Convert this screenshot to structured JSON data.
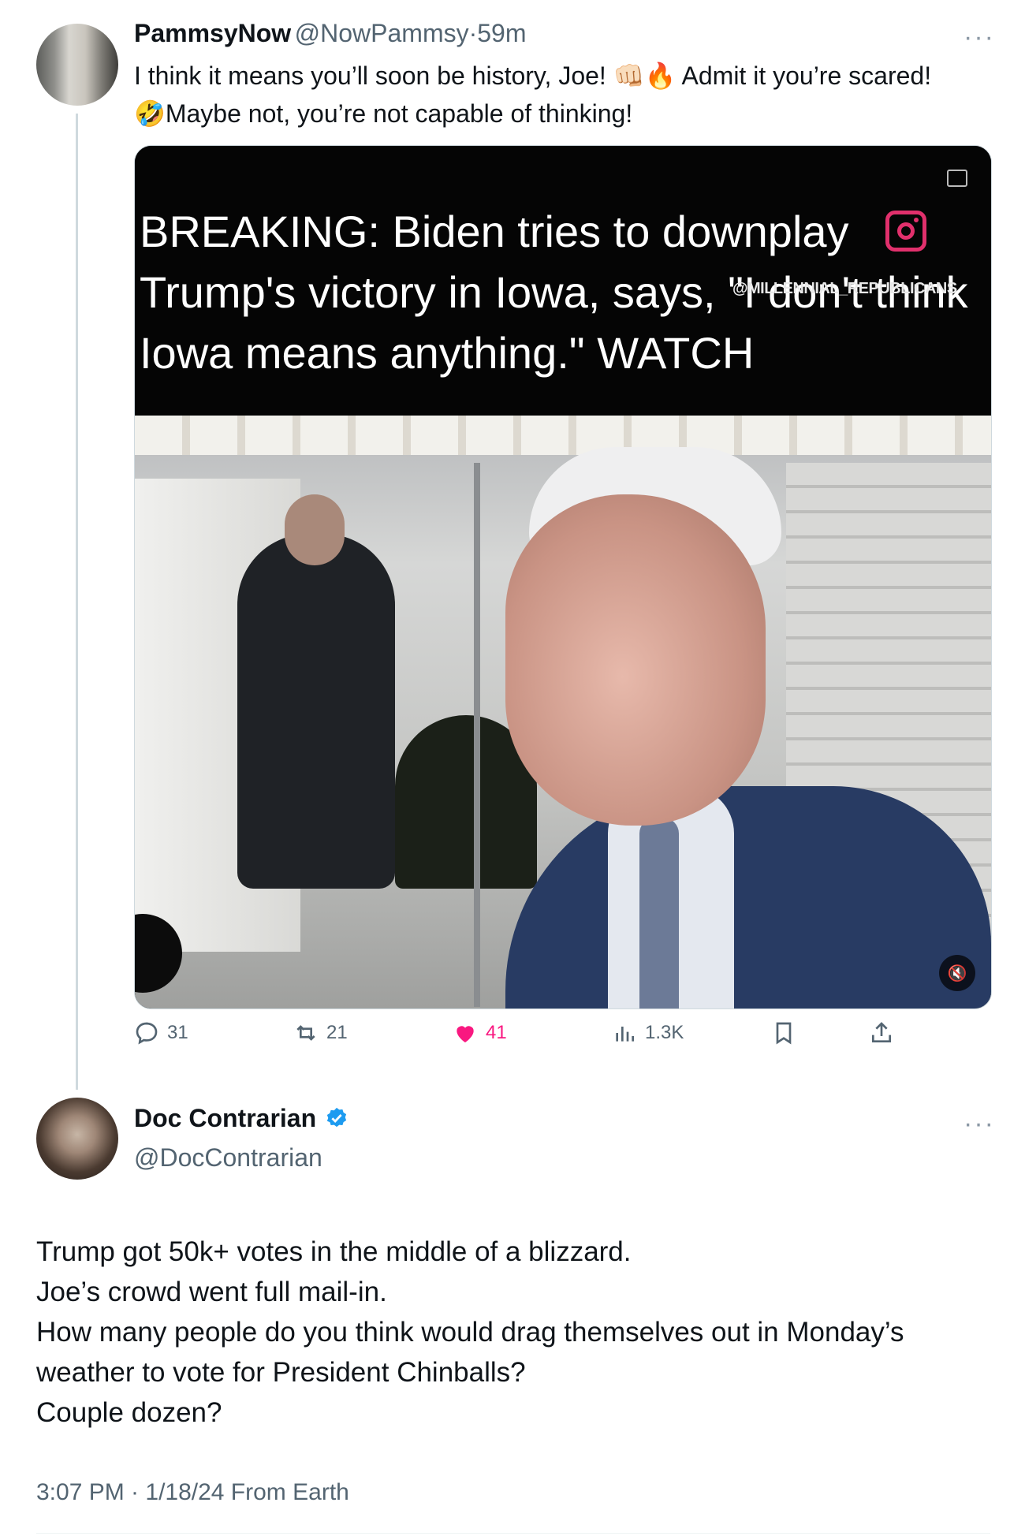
{
  "reply_tweet": {
    "display_name": "PammsyNow",
    "handle": "@NowPammsy",
    "separator": "·",
    "time_ago": "59m",
    "text_line1": "I think it means you’ll soon be history, Joe! 👊🏻🔥 Admit it you’re scared!",
    "text_line2": "🤣Maybe not,  you’re not capable of thinking!",
    "media": {
      "headline_line1": "BREAKING: Biden tries to downplay",
      "headline_line2": "Trump's victory in Iowa, says, \"I don't think",
      "headline_line3": "Iowa means anything.\" WATCH",
      "watermark": "@MILLENNIAL_REPUBLICANS",
      "instagram_color": "#e1306c"
    },
    "actions": {
      "replies": "31",
      "reposts": "21",
      "likes": "41",
      "views": "1.3K"
    },
    "like_color": "#f91880"
  },
  "main_tweet": {
    "display_name": "Doc Contrarian",
    "handle": "@DocContrarian",
    "verified_color": "#1d9bf0",
    "text_lines": [
      "Trump got 50k+ votes in the middle of a blizzard.",
      "Joe’s crowd went full mail-in.",
      "How many people do you think would drag themselves out in Monday’s",
      "weather to vote for President Chinballs?",
      "Couple dozen?"
    ],
    "timestamp": "3:07 PM · 1/18/24 From Earth"
  },
  "more_label": "···",
  "icons": [
    "reply-icon",
    "repost-icon",
    "like-icon",
    "views-icon",
    "bookmark-icon",
    "share-icon",
    "verified-icon",
    "more-icon",
    "mute-icon",
    "captions-icon",
    "instagram-icon"
  ]
}
